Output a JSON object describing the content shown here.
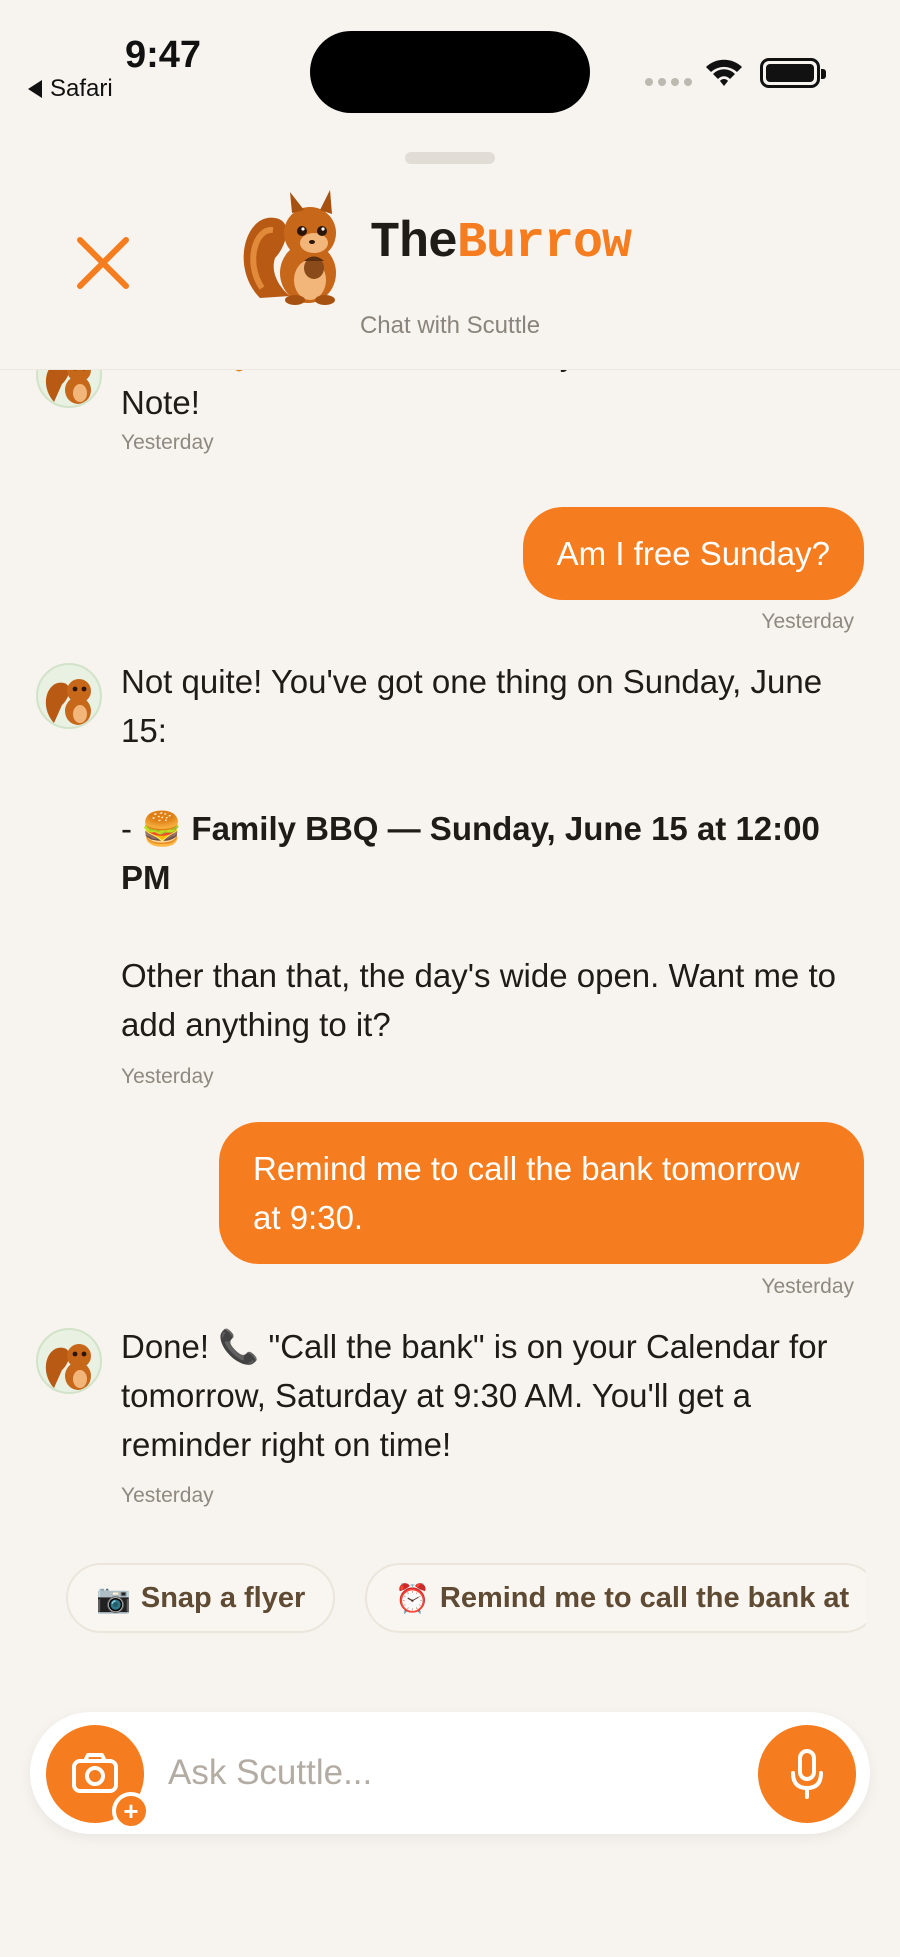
{
  "status": {
    "time": "9:47",
    "back_app": "Safari"
  },
  "header": {
    "brand_the": "The",
    "brand_burrow": "Burrow",
    "subtitle": "Chat with Scuttle"
  },
  "messages": [
    {
      "role": "bot",
      "text_line1": "Done! 🍞 \"Bread\" is added to your Forever",
      "text_line2": "Note!",
      "time": "Yesterday"
    },
    {
      "role": "user",
      "text": "Am I free Sunday?",
      "time": "Yesterday"
    },
    {
      "role": "bot",
      "intro": "Not quite! You've got one thing on Sunday, June 15:",
      "item_prefix": "- 🍔 ",
      "item_bold": "Family BBQ — Sunday, June 15 at 12:00 PM",
      "outro": "Other than that, the day's wide open. Want me to add anything to it?",
      "time": "Yesterday"
    },
    {
      "role": "user",
      "text": "Remind me to call the bank tomorrow at 9:30.",
      "time": "Yesterday"
    },
    {
      "role": "bot",
      "text": "Done! 📞 \"Call the bank\" is on your Calendar for tomorrow, Saturday at 9:30 AM. You'll get a reminder right on time!",
      "time": "Yesterday"
    }
  ],
  "chips": [
    {
      "emoji": "📷",
      "label": "Snap a flyer"
    },
    {
      "emoji": "⏰",
      "label": "Remind me to call the bank at"
    }
  ],
  "input": {
    "placeholder": "Ask Scuttle..."
  },
  "colors": {
    "accent": "#f57c1f",
    "background": "#f7f4ef"
  }
}
